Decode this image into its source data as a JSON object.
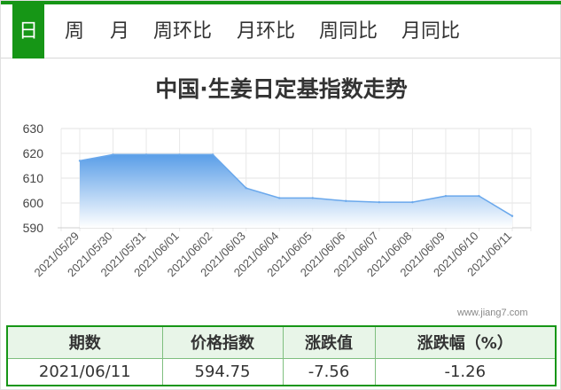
{
  "tabs": [
    {
      "label": "日",
      "active": true
    },
    {
      "label": "周",
      "active": false
    },
    {
      "label": "月",
      "active": false
    },
    {
      "label": "周环比",
      "active": false
    },
    {
      "label": "月环比",
      "active": false
    },
    {
      "label": "周同比",
      "active": false
    },
    {
      "label": "月同比",
      "active": false
    }
  ],
  "title": "中国·生姜日定基指数走势",
  "watermark": "www.jiang7.com",
  "chart_data": {
    "type": "area",
    "title": "中国·生姜日定基指数走势",
    "xlabel": "",
    "ylabel": "",
    "x": [
      "2021/05/29",
      "2021/05/30",
      "2021/05/31",
      "2021/06/01",
      "2021/06/02",
      "2021/06/03",
      "2021/06/04",
      "2021/06/05",
      "2021/06/06",
      "2021/06/07",
      "2021/06/08",
      "2021/06/09",
      "2021/06/10",
      "2021/06/11"
    ],
    "series": [
      {
        "values": [
          617,
          619.5,
          619.5,
          619.5,
          619.5,
          606,
          602,
          602,
          600.8,
          600.3,
          600.3,
          602.8,
          602.8,
          594.75
        ]
      }
    ],
    "yticks": [
      "630",
      "620",
      "610",
      "600",
      "590"
    ],
    "ylim": [
      590,
      630
    ],
    "grid": true,
    "colors": {
      "fill_top": "#5a9ee8",
      "fill_bottom": "#ffffff",
      "line": "#6aa8ec"
    }
  },
  "table": {
    "headers": [
      "期数",
      "价格指数",
      "涨跌值",
      "涨跌幅（%）"
    ],
    "row": [
      "2021/06/11",
      "594.75",
      "-7.56",
      "-1.26"
    ]
  },
  "colors": {
    "accent": "#169616",
    "table_border": "#7fbf7f",
    "table_head_bg": "#e8f5e8"
  }
}
